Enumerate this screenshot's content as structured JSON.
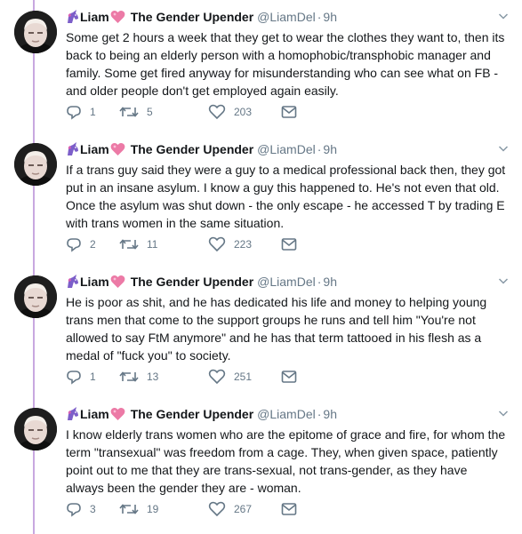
{
  "colors": {
    "thread_line": "#c8a8e0",
    "secondary_text": "#657786",
    "heart": "#e0245e"
  },
  "tweets": [
    {
      "name": "Liam",
      "display_name": "The Gender Upender",
      "handle": "@LiamDel",
      "dot": "·",
      "time": "9h",
      "text": "Some get 2 hours a week that they get to wear the clothes they want to, then its back to being an elderly person with a homophobic/transphobic manager and family. Some get fired anyway for misunderstanding who can see what on FB - and older people don't get employed again easily.",
      "replies": "1",
      "retweets": "5",
      "likes": "203"
    },
    {
      "name": "Liam",
      "display_name": "The Gender Upender",
      "handle": "@LiamDel",
      "dot": "·",
      "time": "9h",
      "text": "If a trans guy said they were a guy to a medical professional back then, they got put in an insane asylum. I know a guy this happened to. He's not even that old. Once the asylum was shut down - the only escape - he accessed T by trading E with trans women in the same situation.",
      "replies": "2",
      "retweets": "11",
      "likes": "223"
    },
    {
      "name": "Liam",
      "display_name": "The Gender Upender",
      "handle": "@LiamDel",
      "dot": "·",
      "time": "9h",
      "text": "He is poor as shit, and he has dedicated his life and money to helping young trans men that come to the support groups he runs and tell him \"You're not allowed to say FtM anymore\" and he has that term tattooed in his flesh as a medal of \"fuck you\" to society.",
      "replies": "1",
      "retweets": "13",
      "likes": "251"
    },
    {
      "name": "Liam",
      "display_name": "The Gender Upender",
      "handle": "@LiamDel",
      "dot": "·",
      "time": "9h",
      "text": "I know elderly trans women who are the epitome of grace and fire, for whom the term \"transexual\" was freedom from a cage. They, when given space, patiently point out to me that they are trans-sexual, not trans-gender, as they have always been the gender they are - woman.",
      "replies": "3",
      "retweets": "19",
      "likes": "267"
    }
  ]
}
